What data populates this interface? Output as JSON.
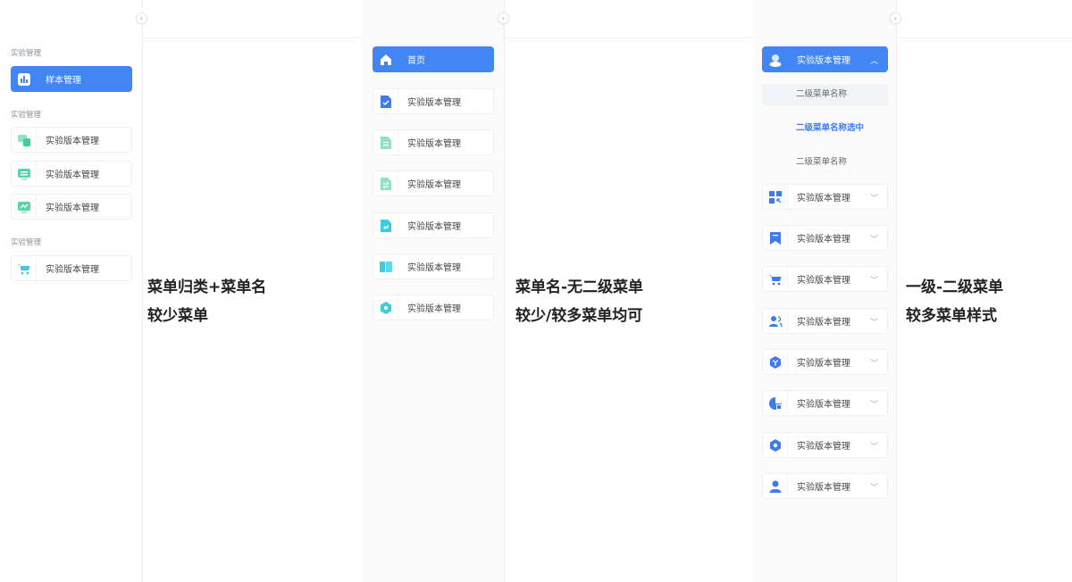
{
  "sidebar_1": {
    "groups": [
      {
        "label": "实验管理",
        "items": [
          {
            "label": "样本管理",
            "icon": "bar-chart-icon",
            "active": true
          }
        ]
      },
      {
        "label": "实验管理",
        "items": [
          {
            "label": "实验版本管理",
            "icon": "devices-icon"
          },
          {
            "label": "实验版本管理",
            "icon": "message-icon"
          },
          {
            "label": "实验版本管理",
            "icon": "monitor-chart-icon"
          }
        ]
      },
      {
        "label": "实验管理",
        "items": [
          {
            "label": "实验版本管理",
            "icon": "cart-icon"
          }
        ]
      }
    ]
  },
  "caption_1": {
    "line1": "菜单归类+菜单名",
    "line2": "较少菜单"
  },
  "sidebar_2": {
    "items": [
      {
        "label": "首页",
        "icon": "home-icon",
        "active": true
      },
      {
        "label": "实验版本管理",
        "icon": "doc-check-icon"
      },
      {
        "label": "实验版本管理",
        "icon": "doc-lines-icon"
      },
      {
        "label": "实验版本管理",
        "icon": "doc-swap-icon"
      },
      {
        "label": "实验版本管理",
        "icon": "doc-return-icon"
      },
      {
        "label": "实验版本管理",
        "icon": "book-icon"
      },
      {
        "label": "实验版本管理",
        "icon": "hexagon-icon"
      }
    ]
  },
  "caption_2": {
    "line1": "菜单名-无二级菜单",
    "line2": "较少/较多菜单均可"
  },
  "sidebar_3": {
    "expanded": {
      "label": "实验版本管理",
      "icon": "cloud-user-icon"
    },
    "sub_items": [
      {
        "label": "二级菜单名称",
        "state": "hover"
      },
      {
        "label": "二级菜单名称选中",
        "state": "selected"
      },
      {
        "label": "二级菜单名称",
        "state": "normal"
      }
    ],
    "items": [
      {
        "label": "实验版本管理",
        "icon": "qr-grid-icon"
      },
      {
        "label": "实验版本管理",
        "icon": "bookmark-icon"
      },
      {
        "label": "实验版本管理",
        "icon": "cart-icon"
      },
      {
        "label": "实验版本管理",
        "icon": "users-icon"
      },
      {
        "label": "实验版本管理",
        "icon": "cube-icon"
      },
      {
        "label": "实验版本管理",
        "icon": "pie-icon"
      },
      {
        "label": "实验版本管理",
        "icon": "hexagon-icon"
      },
      {
        "label": "实验版本管理",
        "icon": "user-icon"
      }
    ]
  },
  "caption_3": {
    "line1": "一级-二级菜单",
    "line2": "较多菜单样式"
  },
  "icons": {
    "collapse": "chevron-left-icon",
    "expand": "chevron-down-icon",
    "collapse_up": "chevron-up-icon"
  },
  "colors": {
    "primary": "#4285f4",
    "green": "#5ad3a8",
    "cyan": "#3ccbe0",
    "blue": "#3d7bef",
    "selected_text": "#3c7ef0"
  }
}
